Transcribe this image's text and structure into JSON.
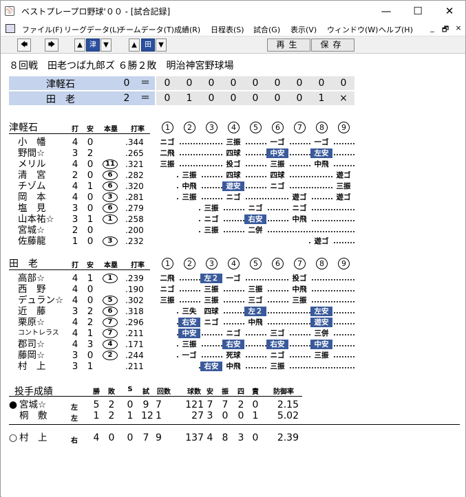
{
  "window": {
    "title": "ベストプレープロ野球'００ - [試合記録]",
    "min": "—",
    "max": "☐",
    "close": "✕"
  },
  "menu": {
    "items": [
      "ファイル(F)",
      "リーグデータ(L)",
      "チームデータ(T)",
      "成績(R)",
      "日程表(S)",
      "試合(G)",
      "表示(V)",
      "ウィンドウ(W)",
      "ヘルプ(H)"
    ],
    "mdi": [
      "_",
      "🗗",
      "×"
    ]
  },
  "toolbar": {
    "team1": "津",
    "team2": "田",
    "replay": "再生",
    "save": "保存"
  },
  "game": {
    "title": "８回戦　田老つば九郎ズ ６勝２敗　明治神宮野球場"
  },
  "scoreboard": {
    "rows": [
      {
        "team": "津軽石",
        "total": "0",
        "eq": "＝",
        "innings": [
          "0",
          "0",
          "0",
          "0",
          "0",
          "0",
          "0",
          "0",
          "0"
        ]
      },
      {
        "team": "田　老",
        "total": "2",
        "eq": "＝",
        "innings": [
          "0",
          "1",
          "0",
          "0",
          "0",
          "0",
          "0",
          "1",
          "×"
        ]
      }
    ]
  },
  "headers": {
    "ab": "打",
    "h": "安",
    "hr": "本塁",
    "avg": "打率",
    "innings": [
      "1",
      "2",
      "3",
      "4",
      "5",
      "6",
      "7",
      "8",
      "9"
    ]
  },
  "team1": {
    "name": "津軽石",
    "batters": [
      {
        "name": "小　幡",
        "ab": "4",
        "h": "0",
        "hr": "",
        "avg": ".344",
        "res": [
          [
            "ニゴ",
            0
          ],
          [
            "三振",
            3
          ],
          [
            "一ゴ",
            5
          ],
          [
            "一ゴ",
            7
          ]
        ]
      },
      {
        "name": "野間☆",
        "ab": "3",
        "h": "2",
        "hr": "",
        "avg": ".265",
        "res": [
          [
            "二飛",
            0
          ],
          [
            "四球",
            3
          ],
          [
            "中安",
            5,
            true
          ],
          [
            "左安",
            7,
            true
          ]
        ]
      },
      {
        "name": "メリル",
        "ab": "4",
        "h": "0",
        "hr": "11",
        "avg": ".321",
        "res": [
          [
            "三振",
            0
          ],
          [
            "投ゴ",
            3
          ],
          [
            "三振",
            5
          ],
          [
            "中飛",
            7
          ]
        ]
      },
      {
        "name": "清　宮",
        "ab": "2",
        "h": "0",
        "hr": "6",
        "avg": ".282",
        "res": [
          [
            "三振",
            1
          ],
          [
            "四球",
            3
          ],
          [
            "四球",
            5
          ],
          [
            "遊ゴ",
            8
          ]
        ]
      },
      {
        "name": "チゾム",
        "ab": "4",
        "h": "1",
        "hr": "6",
        "avg": ".320",
        "res": [
          [
            "中飛",
            1
          ],
          [
            "遊安",
            3,
            true
          ],
          [
            "ニゴ",
            5
          ],
          [
            "三振",
            8
          ]
        ]
      },
      {
        "name": "岡　本",
        "ab": "4",
        "h": "0",
        "hr": "3",
        "avg": ".281",
        "res": [
          [
            "三振",
            1
          ],
          [
            "ニゴ",
            3
          ],
          [
            "遊ゴ",
            6
          ],
          [
            "遊ゴ",
            8
          ]
        ]
      },
      {
        "name": "塩　見",
        "ab": "3",
        "h": "0",
        "hr": "6",
        "avg": ".279",
        "res": [
          [
            "三振",
            2
          ],
          [
            "ニゴ",
            4
          ],
          [
            "ニゴ",
            6
          ]
        ]
      },
      {
        "name": "山本祐☆",
        "ab": "3",
        "h": "1",
        "hr": "1",
        "avg": ".258",
        "res": [
          [
            "ニゴ",
            2
          ],
          [
            "右安",
            4,
            true
          ],
          [
            "中飛",
            6
          ]
        ]
      },
      {
        "name": "宮城☆",
        "ab": "2",
        "h": "0",
        "hr": "",
        "avg": ".200",
        "res": [
          [
            "三振",
            2
          ],
          [
            "二併",
            4
          ]
        ]
      },
      {
        "name": "佐藤龍",
        "ab": "1",
        "h": "0",
        "hr": "3",
        "avg": ".232",
        "res": [
          [
            "遊ゴ",
            7
          ]
        ]
      }
    ]
  },
  "team2": {
    "name": "田　老",
    "batters": [
      {
        "name": "高部☆",
        "ab": "4",
        "h": "1",
        "hr": "1",
        "avg": ".239",
        "res": [
          [
            "二飛",
            0
          ],
          [
            "左２",
            2,
            true
          ],
          [
            "一ゴ",
            3
          ],
          [
            "投ゴ",
            6
          ]
        ]
      },
      {
        "name": "西　野",
        "ab": "4",
        "h": "0",
        "hr": "",
        "avg": ".190",
        "res": [
          [
            "ニゴ",
            0
          ],
          [
            "三振",
            2
          ],
          [
            "三振",
            4
          ],
          [
            "中飛",
            6
          ]
        ]
      },
      {
        "name": "デュラン☆",
        "ab": "4",
        "h": "0",
        "hr": "5",
        "avg": ".302",
        "res": [
          [
            "三振",
            0
          ],
          [
            "三振",
            2
          ],
          [
            "三ゴ",
            4
          ],
          [
            "三振",
            6
          ]
        ]
      },
      {
        "name": "近　藤",
        "ab": "3",
        "h": "2",
        "hr": "6",
        "avg": ".318",
        "res": [
          [
            "三失",
            1
          ],
          [
            "四球",
            2
          ],
          [
            "左２",
            4,
            true
          ],
          [
            "左安",
            7,
            true
          ]
        ]
      },
      {
        "name": "栗原☆",
        "ab": "4",
        "h": "2",
        "hr": "7",
        "avg": ".296",
        "res": [
          [
            "右安",
            1,
            true
          ],
          [
            "ニゴ",
            2
          ],
          [
            "中飛",
            4
          ],
          [
            "遊安",
            7,
            true
          ]
        ]
      },
      {
        "name": "コントレラス",
        "ab": "4",
        "h": "1",
        "hr": "7",
        "avg": ".211",
        "res": [
          [
            "中安",
            1,
            true
          ],
          [
            "ニゴ",
            3
          ],
          [
            "三ゴ",
            5
          ],
          [
            "三併",
            7
          ]
        ]
      },
      {
        "name": "郡司☆",
        "ab": "4",
        "h": "3",
        "hr": "4",
        "avg": ".171",
        "res": [
          [
            "三振",
            1
          ],
          [
            "右安",
            3,
            true
          ],
          [
            "右安",
            5,
            true
          ],
          [
            "中安",
            7,
            true
          ]
        ]
      },
      {
        "name": "藤岡☆",
        "ab": "3",
        "h": "0",
        "hr": "2",
        "avg": ".244",
        "res": [
          [
            "一ゴ",
            1
          ],
          [
            "死球",
            3
          ],
          [
            "ニゴ",
            5
          ],
          [
            "三振",
            7
          ]
        ]
      },
      {
        "name": "村　上",
        "ab": "3",
        "h": "1",
        "hr": "",
        "avg": ".211",
        "res": [
          [
            "右安",
            2,
            true
          ],
          [
            "中飛",
            3
          ],
          [
            "三振",
            5
          ]
        ]
      }
    ]
  },
  "pitching": {
    "title": "投手成績",
    "headers": [
      "勝",
      "敗",
      "S",
      "試",
      "回数",
      "球数",
      "安",
      "振",
      "四",
      "責",
      "防御率"
    ],
    "team1": [
      {
        "mark": "●",
        "name": "宮城☆",
        "hand": "左",
        "stats": [
          "5",
          "2",
          "0",
          "9",
          "7",
          "121",
          "7",
          "7",
          "2",
          "0",
          "2.15"
        ]
      },
      {
        "mark": "",
        "name": "桐　敷",
        "hand": "左",
        "stats": [
          "1",
          "2",
          "1",
          "12",
          "1",
          "27",
          "3",
          "0",
          "0",
          "1",
          "5.02"
        ]
      }
    ],
    "team2": [
      {
        "mark": "○",
        "name": "村　上",
        "hand": "右",
        "stats": [
          "4",
          "0",
          "0",
          "7",
          "9",
          "137",
          "4",
          "8",
          "3",
          "0",
          "2.39"
        ]
      }
    ]
  }
}
